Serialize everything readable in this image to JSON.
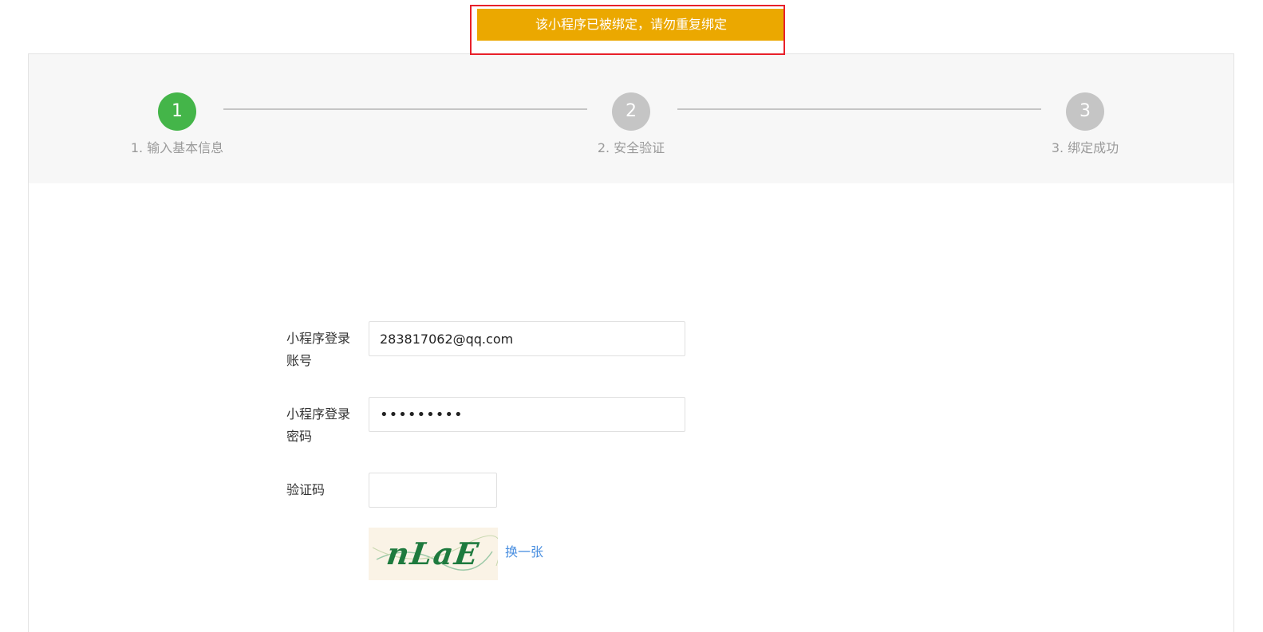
{
  "toast": {
    "message": "该小程序已被绑定，请勿重复绑定"
  },
  "steps": [
    {
      "number": "1",
      "label": "1. 输入基本信息",
      "state": "active"
    },
    {
      "number": "2",
      "label": "2. 安全验证",
      "state": "pending"
    },
    {
      "number": "3",
      "label": "3. 绑定成功",
      "state": "pending"
    }
  ],
  "form": {
    "account_label": "小程序登录账号",
    "account_value": "283817062@qq.com",
    "password_label": "小程序登录密码",
    "password_value": "123456789",
    "captcha_label": "验证码",
    "captcha_value": "",
    "captcha_image_text": "nLaE",
    "refresh_label": "换一张"
  },
  "colors": {
    "toast_bg": "#eba800",
    "toast_outline": "#e8202a",
    "step_active": "#44b549",
    "step_pending": "#c5c5c5",
    "link": "#4a8fe0"
  }
}
